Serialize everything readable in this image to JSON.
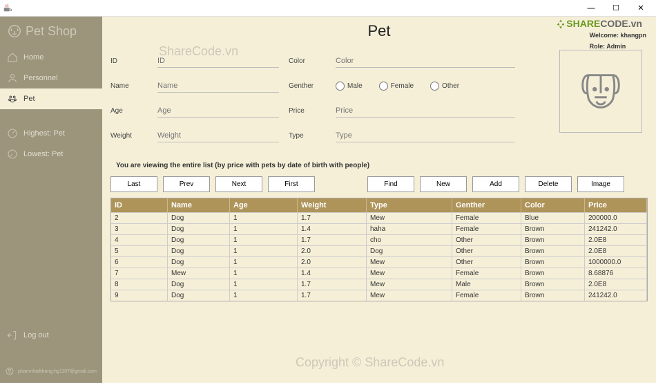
{
  "window": {
    "title": ""
  },
  "titlebar_buttons": {
    "min": "—",
    "max": "☐",
    "close": "✕"
  },
  "brand": "Pet Shop",
  "nav": {
    "home": "Home",
    "personnel": "Personnel",
    "pet": "Pet",
    "highest": "Highest: Pet",
    "lowest": "Lowest: Pet",
    "logout": "Log out"
  },
  "user_email": "phamnhatkhang.hg1107@gmail.com",
  "page_title": "Pet",
  "welcome": "Welcome: khangpn",
  "role": "Role: Admin",
  "form": {
    "id_label": "ID",
    "id_ph": "ID",
    "name_label": "Name",
    "name_ph": "Name",
    "age_label": "Age",
    "age_ph": "Age",
    "weight_label": "Weight",
    "weight_ph": "Weight",
    "color_label": "Color",
    "color_ph": "Color",
    "gender_label": "Genther",
    "gender_opts": {
      "male": "Male",
      "female": "Female",
      "other": "Other"
    },
    "price_label": "Price",
    "price_ph": "Price",
    "type_label": "Type",
    "type_ph": "Type"
  },
  "viewing_text": "You are viewing the entire list (by price with pets by date of birth with people)",
  "buttons": {
    "last": "Last",
    "prev": "Prev",
    "next": "Next",
    "first": "First",
    "find": "Find",
    "new": "New",
    "add": "Add",
    "delete": "Delete",
    "image": "Image"
  },
  "table": {
    "headers": {
      "id": "ID",
      "name": "Name",
      "age": "Age",
      "weight": "Weight",
      "type": "Type",
      "gender": "Genther",
      "color": "Color",
      "price": "Price"
    },
    "rows": [
      {
        "id": "2",
        "name": "Dog",
        "age": "1",
        "weight": "1.7",
        "type": "Mew",
        "gender": "Female",
        "color": "Blue",
        "price": "200000.0"
      },
      {
        "id": "3",
        "name": "Dog",
        "age": "1",
        "weight": "1.4",
        "type": "haha",
        "gender": "Female",
        "color": "Brown",
        "price": "241242.0"
      },
      {
        "id": "4",
        "name": "Dog",
        "age": "1",
        "weight": "1.7",
        "type": "cho",
        "gender": "Other",
        "color": "Brown",
        "price": "2.0E8"
      },
      {
        "id": "5",
        "name": "Dog",
        "age": "1",
        "weight": "2.0",
        "type": "Dog",
        "gender": "Other",
        "color": "Brown",
        "price": "2.0E8"
      },
      {
        "id": "6",
        "name": "Dog",
        "age": "1",
        "weight": "2.0",
        "type": "Mew",
        "gender": "Other",
        "color": "Brown",
        "price": "1000000.0"
      },
      {
        "id": "7",
        "name": "Mew",
        "age": "1",
        "weight": "1.4",
        "type": "Mew",
        "gender": "Female",
        "color": "Brown",
        "price": "8.68876"
      },
      {
        "id": "8",
        "name": "Dog",
        "age": "1",
        "weight": "1.7",
        "type": "Mew",
        "gender": "Male",
        "color": "Brown",
        "price": "2.0E8"
      },
      {
        "id": "9",
        "name": "Dog",
        "age": "1",
        "weight": "1.7",
        "type": "Mew",
        "gender": "Female",
        "color": "Brown",
        "price": "241242.0"
      }
    ]
  },
  "watermarks": {
    "wm1": "ShareCode.vn",
    "wm2": "Copyright © ShareCode.vn"
  },
  "sharecode_logo": {
    "green": "SHARE",
    "gray": "CODE.vn"
  }
}
